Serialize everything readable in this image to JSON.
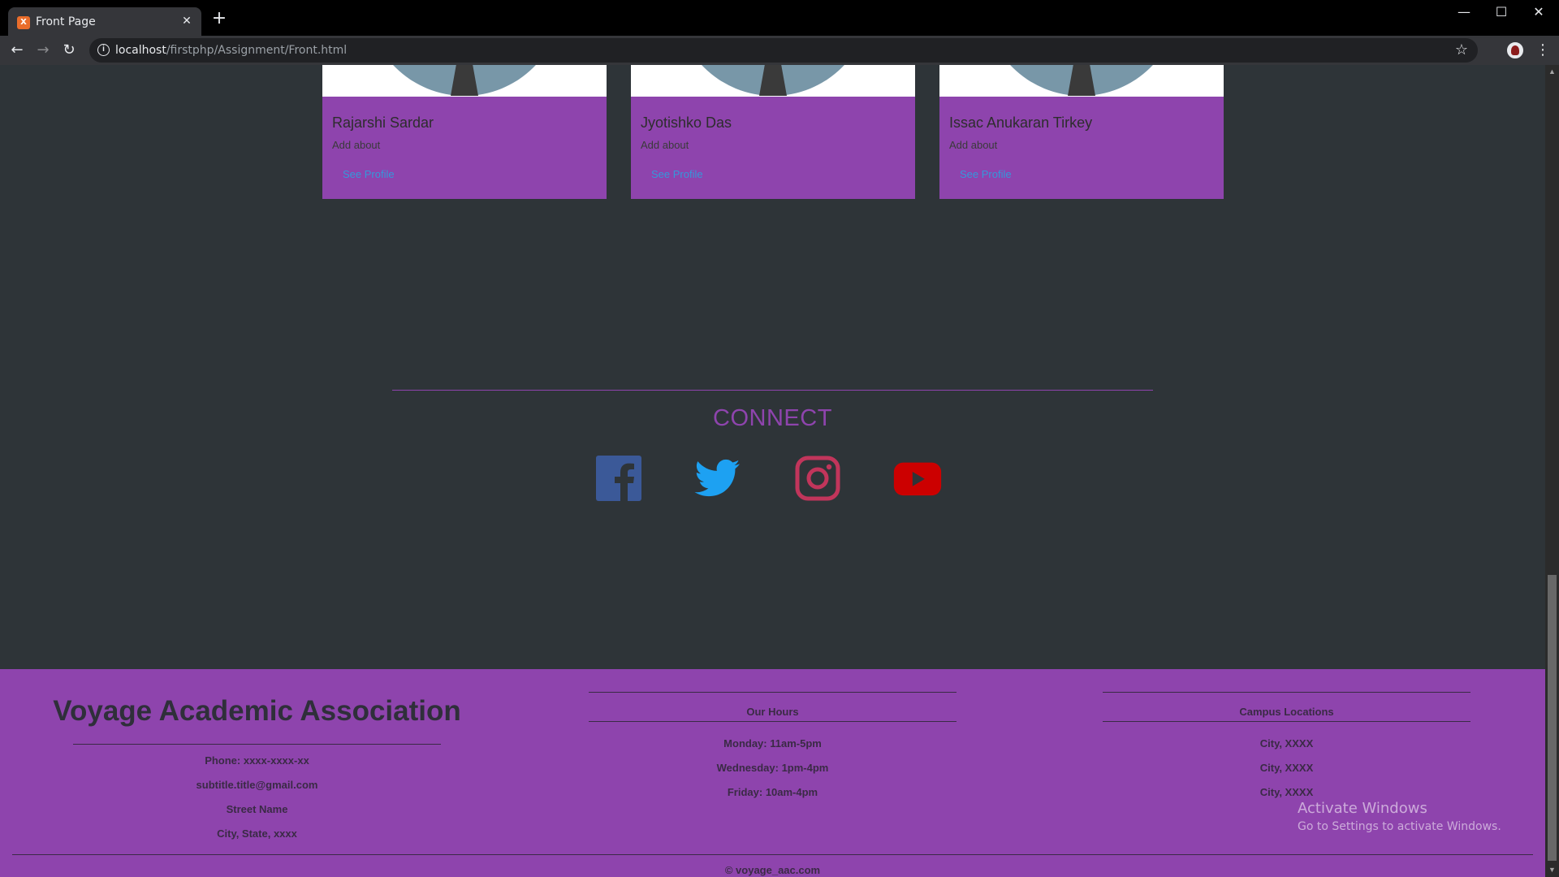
{
  "browser": {
    "tab_title": "Front Page",
    "tab_favicon": "X",
    "close_glyph": "✕",
    "new_tab_glyph": "+",
    "url_host": "localhost",
    "url_path": "/firstphp/Assignment/Front.html",
    "info_glyph": "i",
    "back_glyph": "←",
    "forward_glyph": "→",
    "reload_glyph": "↻",
    "star_glyph": "☆",
    "menu_glyph": "⋮",
    "minimize_glyph": "—",
    "maximize_glyph": "☐",
    "window_close_glyph": "✕"
  },
  "team": [
    {
      "name": "Rajarshi Sardar",
      "about": "Add about",
      "link": "See Profile"
    },
    {
      "name": "Jyotishko Das",
      "about": "Add about",
      "link": "See Profile"
    },
    {
      "name": "Issac Anukaran Tirkey",
      "about": "Add about",
      "link": "See Profile"
    }
  ],
  "connect": {
    "title": "CONNECT",
    "icons": [
      "facebook-icon",
      "twitter-icon",
      "instagram-icon",
      "youtube-icon"
    ],
    "colors": {
      "facebook": "#3b5998",
      "twitter": "#1da1f2",
      "instagram": "#c1355b",
      "youtube": "#cc0000"
    }
  },
  "footer": {
    "org_name": "Voyage Academic Association",
    "contact": [
      "Phone: xxxx-xxxx-xx",
      "subtitle.title@gmail.com",
      "Street Name",
      "City, State, xxxx"
    ],
    "hours_title": "Our Hours",
    "hours": [
      "Monday: 11am-5pm",
      "Wednesday: 1pm-4pm",
      "Friday: 10am-4pm"
    ],
    "campus_title": "Campus Locations",
    "campus": [
      "City, XXXX",
      "City, XXXX",
      "City, XXXX"
    ],
    "copyright": "© voyage_aac.com"
  },
  "watermark": {
    "line1": "Activate Windows",
    "line2": "Go to Settings to activate Windows."
  },
  "colors": {
    "page_bg": "#2e3438",
    "accent_purple": "#8e44ad",
    "link_blue": "#3498db"
  }
}
